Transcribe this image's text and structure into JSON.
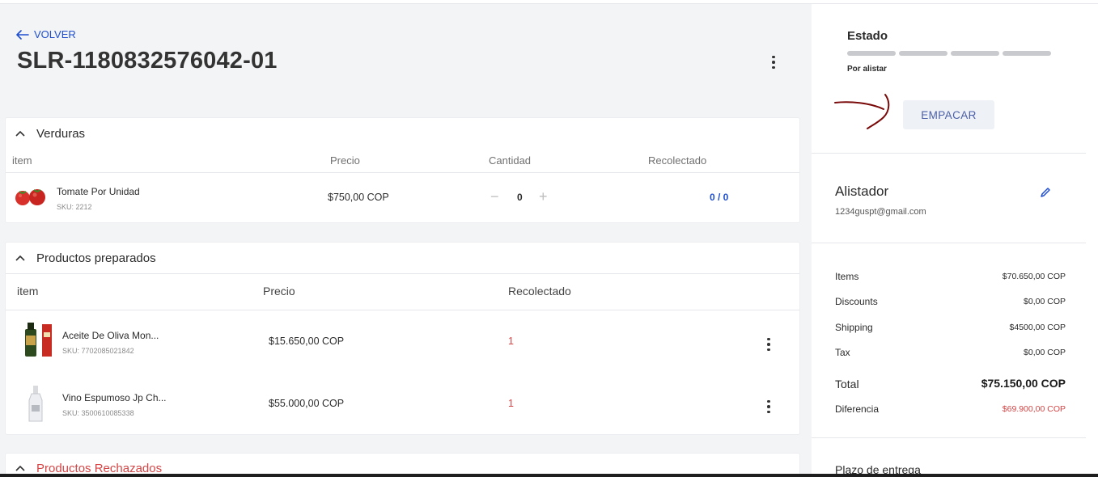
{
  "nav": {
    "back_label": "VOLVER"
  },
  "order": {
    "id": "SLR-1180832576042-01"
  },
  "sections": {
    "verduras": {
      "title": "Verduras",
      "columns": [
        "item",
        "Precio",
        "Cantidad",
        "Recolectado"
      ],
      "items": [
        {
          "name": "Tomate Por Unidad",
          "sku": "SKU: 2212",
          "price": "$750,00 COP",
          "quantity": "0",
          "collected": "0 / 0"
        }
      ]
    },
    "preparados": {
      "title": "Productos preparados",
      "columns": [
        "item",
        "Precio",
        "Recolectado"
      ],
      "items": [
        {
          "name": "Aceite De Oliva Mon...",
          "sku": "SKU: 7702085021842",
          "price": "$15.650,00 COP",
          "collected": "1"
        },
        {
          "name": "Vino Espumoso Jp Ch...",
          "sku": "SKU: 3500610085338",
          "price": "$55.000,00 COP",
          "collected": "1"
        }
      ]
    },
    "rechazados": {
      "title": "Productos Rechazados"
    }
  },
  "status": {
    "title": "Estado",
    "label": "Por alistar",
    "action_label": "EMPACAR"
  },
  "picker": {
    "title": "Alistador",
    "email": "1234guspt@gmail.com"
  },
  "summary": {
    "items_label": "Items",
    "items_value": "$70.650,00 COP",
    "discounts_label": "Discounts",
    "discounts_value": "$0,00 COP",
    "shipping_label": "Shipping",
    "shipping_value": "$4500,00 COP",
    "tax_label": "Tax",
    "tax_value": "$0,00 COP",
    "total_label": "Total",
    "total_value": "$75.150,00 COP",
    "difference_label": "Diferencia",
    "difference_value": "$69.900,00 COP"
  },
  "delivery": {
    "title": "Plazo de entrega"
  },
  "colors": {
    "accent": "#1f4fcf",
    "danger": "#d64545",
    "annotation": "#7a0a0a"
  }
}
